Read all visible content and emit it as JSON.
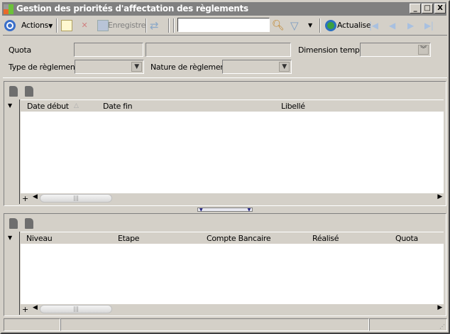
{
  "window": {
    "title": "Gestion des priorités d'affectation des règlements",
    "minimize": "_",
    "maximize": "□",
    "close": "X"
  },
  "toolbar": {
    "actions": "Actions",
    "save": "Enregistre",
    "search_value": "",
    "refresh": "Actualise"
  },
  "filters": {
    "quota_label": "Quota",
    "quota_code": "",
    "quota_name": "",
    "dimension_label": "Dimension temps",
    "dimension_value": "",
    "type_label": "Type de règlement",
    "type_value": "",
    "nature_label": "Nature de règlement",
    "nature_value": ""
  },
  "grid1": {
    "columns": [
      "Date début",
      "Date fin",
      "Libellé"
    ],
    "rows": [],
    "add": "+"
  },
  "grid2": {
    "columns": [
      "Niveau",
      "Etape",
      "Compte Bancaire",
      "Réalisé",
      "Quota"
    ],
    "rows": [],
    "add": "+"
  },
  "status": [
    "",
    "",
    ""
  ]
}
